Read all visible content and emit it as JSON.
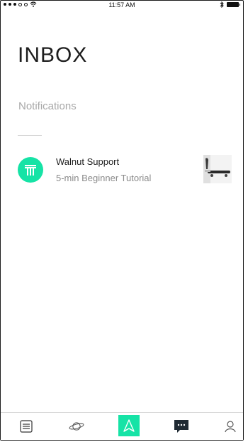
{
  "status_bar": {
    "time": "11:57 AM",
    "icons": [
      "signal-dots-icon",
      "wifi-icon",
      "bluetooth-icon",
      "battery-icon"
    ]
  },
  "page": {
    "title": "INBOX",
    "section_title": "Notifications"
  },
  "notifications": [
    {
      "avatar_icon": "walnut-logo-icon",
      "title": "Walnut Support",
      "subtitle": "5-min Beginner Tutorial",
      "thumbnail_icon": "skateboard-thumbnail"
    }
  ],
  "tabbar": {
    "tabs": [
      {
        "name": "list-icon"
      },
      {
        "name": "planet-icon"
      },
      {
        "name": "navigation-icon",
        "active": true
      },
      {
        "name": "chat-icon"
      },
      {
        "name": "profile-icon"
      }
    ],
    "accent_color": "#16e3a6"
  }
}
